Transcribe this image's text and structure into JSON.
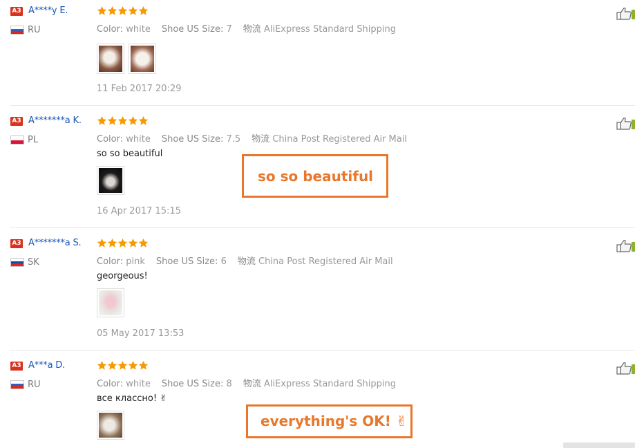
{
  "labels": {
    "color": "Color:",
    "shoe_size": "Shoe US Size:",
    "logistics": "物流"
  },
  "colors": {
    "star": "#f59a00",
    "username": "#1a55b4",
    "badge": "#d9331f",
    "callout": "#e8772b"
  },
  "reviews": [
    {
      "badge": "A3",
      "user": "A****y E.",
      "country": "RU",
      "flag": "flag-russia-icon",
      "rating": 5,
      "color": "white",
      "size": "7",
      "shipping": "AliExpress Standard Shipping",
      "text": "",
      "date": "11 Feb 2017 20:29"
    },
    {
      "badge": "A3",
      "user": "A*******a K.",
      "country": "PL",
      "flag": "flag-poland-icon",
      "rating": 5,
      "color": "white",
      "size": "7.5",
      "shipping": "China Post Registered Air Mail",
      "text": "so so beautiful",
      "date": "16 Apr 2017 15:15"
    },
    {
      "badge": "A3",
      "user": "A*******a S.",
      "country": "SK",
      "flag": "flag-slovakia-icon",
      "rating": 5,
      "color": "pink",
      "size": "6",
      "shipping": "China Post Registered Air Mail",
      "text": "georgeous!",
      "date": "05 May 2017 13:53"
    },
    {
      "badge": "A3",
      "user": "A***a D.",
      "country": "RU",
      "flag": "flag-russia-icon",
      "rating": 5,
      "color": "white",
      "size": "8",
      "shipping": "AliExpress Standard Shipping",
      "text": "все классно! ✌",
      "date": ""
    }
  ],
  "callouts": {
    "first": "so so beautiful",
    "second": "everything's OK! ✌"
  }
}
